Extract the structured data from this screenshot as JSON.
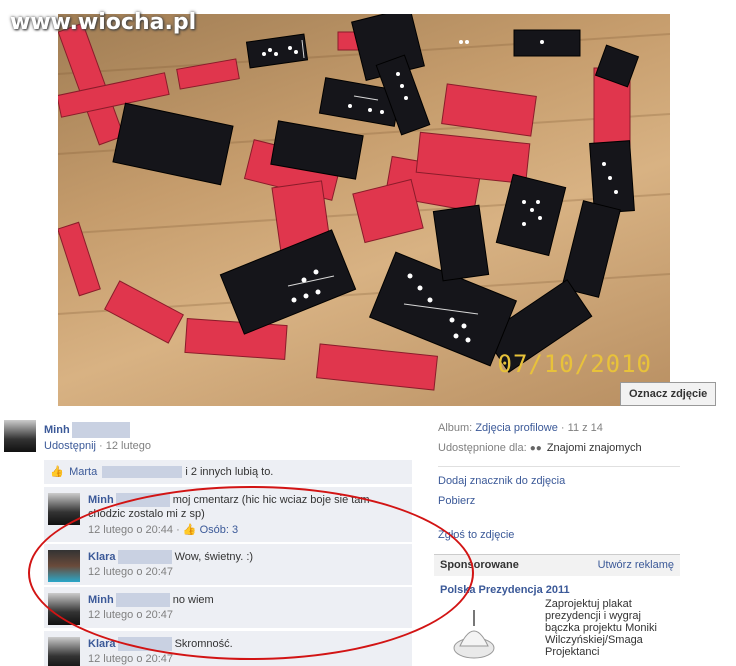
{
  "watermark": {
    "prefix": "www",
    "domain": ".wiocha.pl"
  },
  "photo": {
    "date_stamp": "07/10/2010",
    "tag_button": "Oznacz zdjęcie"
  },
  "poster": {
    "name": "Minh",
    "share": "Udostępnij",
    "date": "· 12 lutego"
  },
  "likes": {
    "name": "Marta",
    "rest": "i 2 innych lubią to."
  },
  "comments": [
    {
      "name": "Minh",
      "text": "moj cmentarz (hic hic wciaz boje sie tam chodzic zostalo mi z sp)",
      "date": "12 lutego o 20:44",
      "extra": "· ",
      "likes": "Osób: 3"
    },
    {
      "name": "Klara",
      "text": "Wow, świetny. :)",
      "date": "12 lutego o 20:47"
    },
    {
      "name": "Minh",
      "text": "no wiem",
      "date": "12 lutego o 20:47"
    },
    {
      "name": "Klara",
      "text": "Skromność.",
      "date": "12 lutego o 20:47"
    }
  ],
  "side": {
    "album_label": "Album:",
    "album_link": "Zdjęcia profilowe",
    "album_count": "· 11 z 14",
    "shared_label": "Udostępnione dla:",
    "shared_value": "Znajomi znajomych",
    "add_tag": "Dodaj znacznik do zdjęcia",
    "download": "Pobierz",
    "report": "Zgłoś to zdjęcie"
  },
  "sponsored": {
    "title": "Sponsorowane",
    "create": "Utwórz reklamę"
  },
  "ad": {
    "title": "Polska Prezydencja 2011",
    "text": "Zaprojektuj plakat prezydencji i wygraj bączka projektu Moniki Wilczyńskiej/Smaga Projektanci"
  },
  "colors": {
    "link": "#3b5998",
    "comment_bg": "#edeff4",
    "annotation": "#d21414"
  }
}
